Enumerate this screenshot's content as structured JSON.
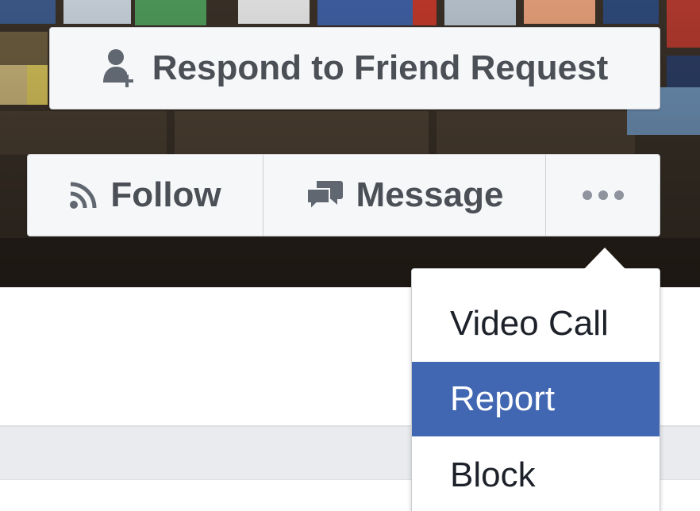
{
  "actions": {
    "respond_label": "Respond to Friend Request",
    "follow_label": "Follow",
    "message_label": "Message"
  },
  "menu": {
    "items": [
      {
        "label": "Video Call"
      },
      {
        "label": "Report",
        "highlighted": true
      },
      {
        "label": "Block"
      }
    ]
  },
  "colors": {
    "button_bg": "#f6f7f9",
    "button_text": "#4b4f56",
    "highlight": "#4267b2",
    "page_gray": "#e9ebee"
  },
  "icons": {
    "respond": "person-plus-icon",
    "follow": "rss-icon",
    "message": "chat-bubbles-icon",
    "more": "ellipsis-icon"
  }
}
